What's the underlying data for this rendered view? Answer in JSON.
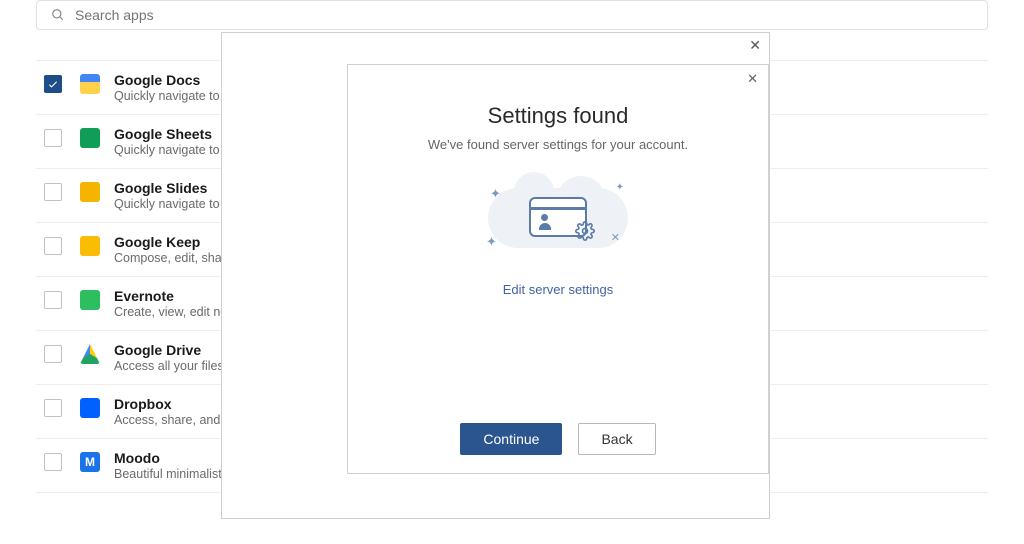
{
  "search": {
    "placeholder": "Search apps"
  },
  "apps": [
    {
      "name": "Google Docs",
      "desc": "Quickly navigate to your docs",
      "checked": true
    },
    {
      "name": "Google Sheets",
      "desc": "Quickly navigate to your sheets",
      "checked": false
    },
    {
      "name": "Google Slides",
      "desc": "Quickly navigate to your slides",
      "checked": false
    },
    {
      "name": "Google Keep",
      "desc": "Compose, edit, share notes",
      "checked": false
    },
    {
      "name": "Evernote",
      "desc": "Create, view, edit notes",
      "checked": false
    },
    {
      "name": "Google Drive",
      "desc": "Access all your files in Drive",
      "checked": false
    },
    {
      "name": "Dropbox",
      "desc": "Access, share, and organize files",
      "checked": false
    },
    {
      "name": "Moodo",
      "desc": "Beautiful minimalistic to-do app",
      "checked": false
    }
  ],
  "modal": {
    "title": "Settings found",
    "subtitle": "We've found server settings for your account.",
    "edit_link": "Edit server settings",
    "continue_label": "Continue",
    "back_label": "Back"
  }
}
